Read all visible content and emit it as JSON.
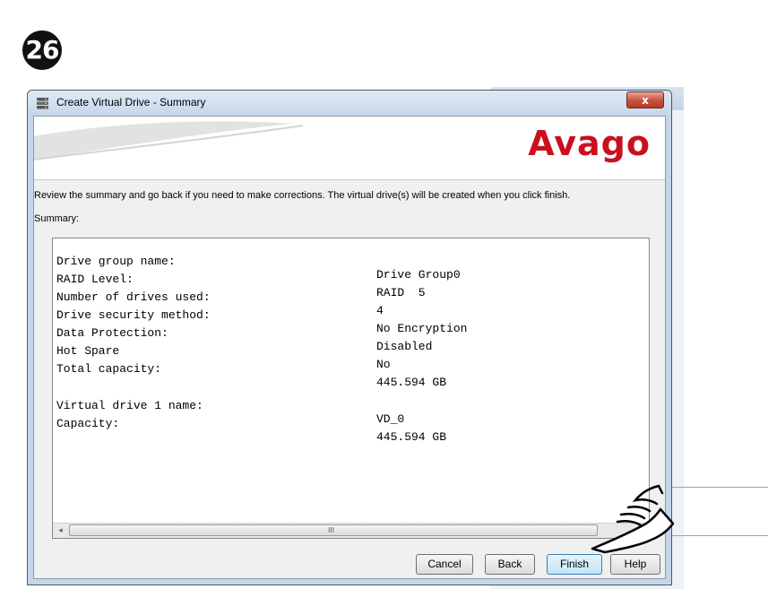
{
  "step": {
    "number": "26"
  },
  "window": {
    "title": "Create Virtual Drive - Summary",
    "close_glyph": "x",
    "icon": "database-icon"
  },
  "banner": {
    "logo_text": "Avago",
    "logo_color": "#cc0f1e"
  },
  "instruction": "Review the summary and go back if you need to make corrections. The virtual drive(s) will be created when you click finish.",
  "summary_label": "Summary:",
  "summary": {
    "rows": [
      {
        "label": "Drive group name:",
        "value": "Drive Group0"
      },
      {
        "label": "RAID Level:",
        "value": "RAID  5"
      },
      {
        "label": "Number of drives used:",
        "value": "4"
      },
      {
        "label": "Drive security method:",
        "value": "No Encryption"
      },
      {
        "label": "Data Protection:",
        "value": "Disabled"
      },
      {
        "label": "Hot Spare",
        "value": "No"
      },
      {
        "label": "Total capacity:",
        "value": "445.594 GB"
      },
      {
        "label": "Virtual drive 1 name:",
        "value": "VD_0"
      },
      {
        "label": "Capacity:",
        "value": "445.594 GB"
      }
    ]
  },
  "scrollbar": {
    "left_arrow": "◂",
    "right_arrow": "▸",
    "grip": "III"
  },
  "buttons": {
    "cancel": "Cancel",
    "back": "Back",
    "finish": "Finish",
    "help": "Help"
  },
  "pointer": {
    "icon": "pointing-hand-icon",
    "target": "Finish"
  }
}
